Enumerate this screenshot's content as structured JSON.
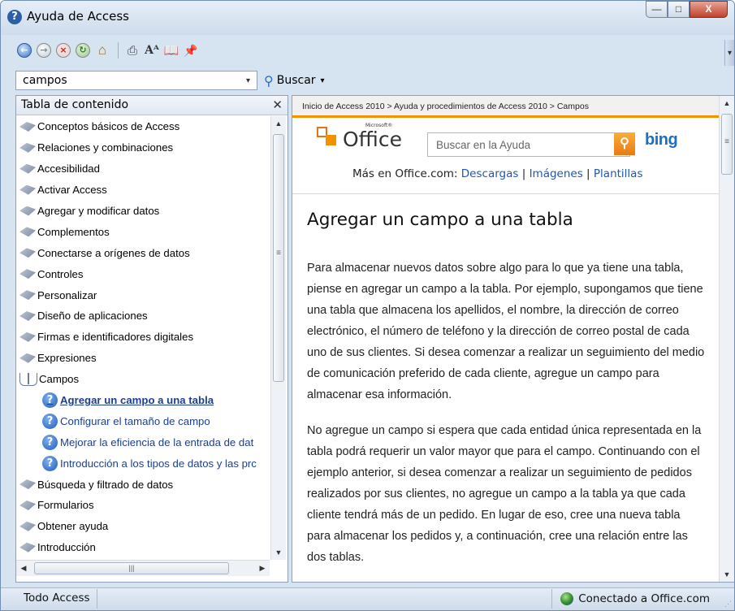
{
  "window": {
    "title": "Ayuda de Access",
    "title_icon": "help-icon",
    "buttons": {
      "minimize": "—",
      "maximize": "□",
      "close": "X"
    }
  },
  "toolbar": {
    "icons": [
      "back-icon",
      "forward-icon",
      "stop-icon",
      "refresh-icon",
      "home-icon",
      "print-icon",
      "font-size-icon",
      "toc-book-icon",
      "pin-icon"
    ]
  },
  "search": {
    "value": "campos",
    "button_label": "Buscar"
  },
  "toc": {
    "header": "Tabla de contenido",
    "close_glyph": "✕",
    "items": [
      {
        "label": "Conceptos básicos de Access",
        "kind": "book"
      },
      {
        "label": "Relaciones y combinaciones",
        "kind": "book"
      },
      {
        "label": "Accesibilidad",
        "kind": "book"
      },
      {
        "label": "Activar Access",
        "kind": "book"
      },
      {
        "label": "Agregar y modificar datos",
        "kind": "book"
      },
      {
        "label": "Complementos",
        "kind": "book"
      },
      {
        "label": "Conectarse a orígenes de datos",
        "kind": "book"
      },
      {
        "label": "Controles",
        "kind": "book"
      },
      {
        "label": "Personalizar",
        "kind": "book"
      },
      {
        "label": "Diseño de aplicaciones",
        "kind": "book"
      },
      {
        "label": "Firmas e identificadores digitales",
        "kind": "book"
      },
      {
        "label": "Expresiones",
        "kind": "book"
      },
      {
        "label": "Campos",
        "kind": "open-book"
      },
      {
        "label": "Agregar un campo a una tabla",
        "kind": "topic",
        "active": true
      },
      {
        "label": "Configurar el tamaño de campo",
        "kind": "topic"
      },
      {
        "label": "Mejorar la eficiencia de la entrada de dat",
        "kind": "topic"
      },
      {
        "label": "Introducción a los tipos de datos y las prc",
        "kind": "topic"
      },
      {
        "label": "Búsqueda y filtrado de datos",
        "kind": "book"
      },
      {
        "label": "Formularios",
        "kind": "book"
      },
      {
        "label": "Obtener ayuda",
        "kind": "book"
      },
      {
        "label": "Introducción",
        "kind": "book"
      }
    ]
  },
  "content": {
    "breadcrumb": "Inicio de Access 2010 > Ayuda y procedimientos de Access 2010 > Campos",
    "brand": {
      "office": "Office",
      "microsoft": "Microsoft®",
      "bing": "bing"
    },
    "help_search_placeholder": "Buscar en la Ayuda",
    "more_prefix": "Más en Office.com:",
    "more_links": [
      "Descargas",
      "Imágenes",
      "Plantillas"
    ],
    "separator": "|",
    "title": "Agregar un campo a una tabla",
    "paragraphs": [
      "Para almacenar nuevos datos sobre algo para lo que ya tiene una tabla, piense en agregar un campo a la tabla. Por ejemplo, supongamos que tiene una tabla que almacena los apellidos, el nombre, la dirección de correo electrónico, el número de teléfono y la dirección de correo postal de cada uno de sus clientes. Si desea comenzar a realizar un seguimiento del medio de comunicación preferido de cada cliente, agregue un campo para almacenar esa información.",
      "No agregue un campo si espera que cada entidad única representada en la tabla podrá requerir un valor mayor que para el campo. Continuando con el ejemplo anterior, si desea comenzar a realizar un seguimiento de pedidos realizados por sus clientes, no agregue un campo a la tabla ya que cada cliente tendrá más de un pedido. En lugar de eso, cree una nueva tabla para almacenar los pedidos y, a continuación, cree una relación entre las dos tablas."
    ]
  },
  "status": {
    "scope": "Todo Access",
    "connection": "Conectado a Office.com"
  },
  "colors": {
    "accent_orange": "#f39200",
    "link_blue": "#1d57b0",
    "bing_blue": "#1e6ec4"
  }
}
